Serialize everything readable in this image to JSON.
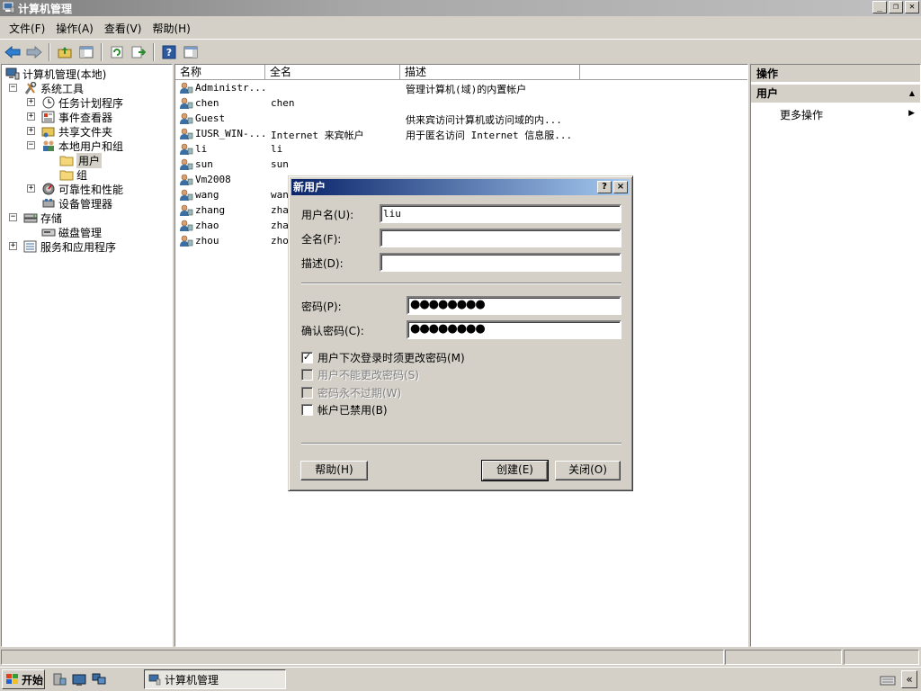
{
  "window": {
    "title": "计算机管理"
  },
  "menu": [
    "文件(F)",
    "操作(A)",
    "查看(V)",
    "帮助(H)"
  ],
  "tree": [
    {
      "label": "计算机管理(本地)",
      "level": 0,
      "expander": "",
      "icon": "computer-icon"
    },
    {
      "label": "系统工具",
      "level": 1,
      "expander": "⊟",
      "icon": "tools-icon"
    },
    {
      "label": "任务计划程序",
      "level": 2,
      "expander": "⊞",
      "icon": "clock-icon"
    },
    {
      "label": "事件查看器",
      "level": 2,
      "expander": "⊞",
      "icon": "event-viewer-icon"
    },
    {
      "label": "共享文件夹",
      "level": 2,
      "expander": "⊞",
      "icon": "shared-folder-icon"
    },
    {
      "label": "本地用户和组",
      "level": 2,
      "expander": "⊟",
      "icon": "users-icon"
    },
    {
      "label": "用户",
      "level": 3,
      "expander": "",
      "icon": "folder-icon",
      "selected": true
    },
    {
      "label": "组",
      "level": 3,
      "expander": "",
      "icon": "folder-icon"
    },
    {
      "label": "可靠性和性能",
      "level": 2,
      "expander": "⊞",
      "icon": "performance-icon"
    },
    {
      "label": "设备管理器",
      "level": 2,
      "expander": "",
      "icon": "device-manager-icon"
    },
    {
      "label": "存储",
      "level": 1,
      "expander": "⊟",
      "icon": "storage-icon"
    },
    {
      "label": "磁盘管理",
      "level": 2,
      "expander": "",
      "icon": "disk-icon"
    },
    {
      "label": "服务和应用程序",
      "level": 1,
      "expander": "⊞",
      "icon": "services-icon"
    }
  ],
  "list": {
    "columns": [
      "名称",
      "全名",
      "描述"
    ],
    "rows": [
      {
        "name": "Administr...",
        "fullname": "",
        "desc": "管理计算机(域)的内置帐户"
      },
      {
        "name": "chen",
        "fullname": "chen",
        "desc": ""
      },
      {
        "name": "Guest",
        "fullname": "",
        "desc": "供来宾访问计算机或访问域的内..."
      },
      {
        "name": "IUSR_WIN-...",
        "fullname": "Internet 来宾帐户",
        "desc": "用于匿名访问 Internet 信息服..."
      },
      {
        "name": "li",
        "fullname": "li",
        "desc": ""
      },
      {
        "name": "sun",
        "fullname": "sun",
        "desc": ""
      },
      {
        "name": "Vm2008",
        "fullname": "",
        "desc": ""
      },
      {
        "name": "wang",
        "fullname": "wan",
        "desc": ""
      },
      {
        "name": "zhang",
        "fullname": "zha",
        "desc": ""
      },
      {
        "name": "zhao",
        "fullname": "zha",
        "desc": ""
      },
      {
        "name": "zhou",
        "fullname": "zho",
        "desc": ""
      }
    ]
  },
  "actions": {
    "header": "操作",
    "section": "用户",
    "more": "更多操作"
  },
  "dialog": {
    "title": "新用户",
    "help_btn": "?",
    "close_btn": "×",
    "username_label": "用户名(U):",
    "username_value": "liu",
    "fullname_label": "全名(F):",
    "fullname_value": "",
    "desc_label": "描述(D):",
    "desc_value": "",
    "password_label": "密码(P):",
    "password_value": "●●●●●●●●",
    "confirm_label": "确认密码(C):",
    "confirm_value": "●●●●●●●●",
    "chk_must_change": {
      "label": "用户下次登录时须更改密码(M)",
      "checked": true,
      "disabled": false
    },
    "chk_cannot_change": {
      "label": "用户不能更改密码(S)",
      "checked": false,
      "disabled": true
    },
    "chk_never_expire": {
      "label": "密码永不过期(W)",
      "checked": false,
      "disabled": true
    },
    "chk_disabled": {
      "label": "帐户已禁用(B)",
      "checked": false,
      "disabled": false
    },
    "help_button": "帮助(H)",
    "create_button": "创建(E)",
    "close_button": "关闭(O)"
  },
  "taskbar": {
    "start": "开始",
    "task": "计算机管理"
  }
}
